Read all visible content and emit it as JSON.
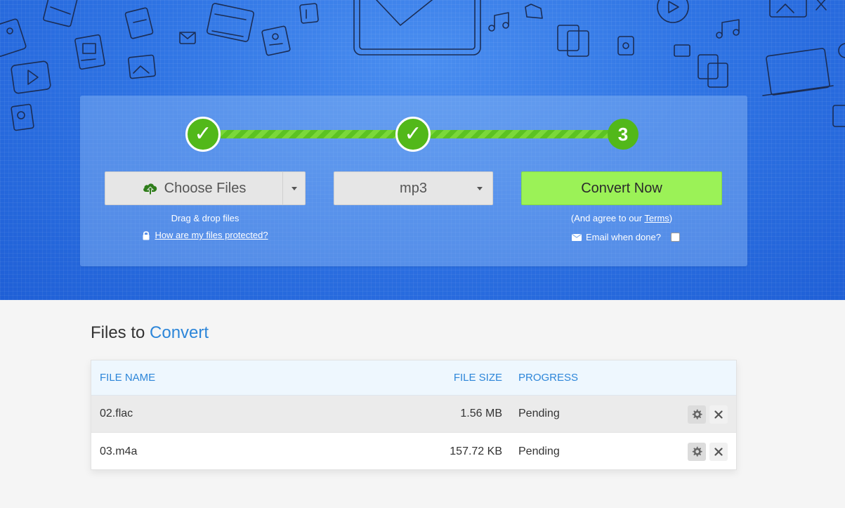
{
  "steps": {
    "step1_mark": "✓",
    "step2_mark": "✓",
    "step3_mark": "3"
  },
  "upload": {
    "choose_label": "Choose Files",
    "drag_hint": "Drag & drop files",
    "protected_link": "How are my files protected?"
  },
  "format": {
    "selected": "mp3"
  },
  "convert": {
    "button_label": "Convert Now",
    "agree_prefix": "(And agree to our ",
    "terms_link": "Terms",
    "agree_suffix": ")",
    "email_label": "Email when done?"
  },
  "files": {
    "title_prefix": "Files to",
    "title_accent": "Convert",
    "columns": {
      "name": "FILE NAME",
      "size": "FILE SIZE",
      "progress": "PROGRESS"
    },
    "rows": [
      {
        "name": "02.flac",
        "size": "1.56 MB",
        "progress": "Pending"
      },
      {
        "name": "03.m4a",
        "size": "157.72 KB",
        "progress": "Pending"
      }
    ]
  },
  "colors": {
    "hero_blue": "#2f74e4",
    "step_green": "#52b81a",
    "convert_green": "#9bf257",
    "accent_blue": "#2d86d9"
  }
}
